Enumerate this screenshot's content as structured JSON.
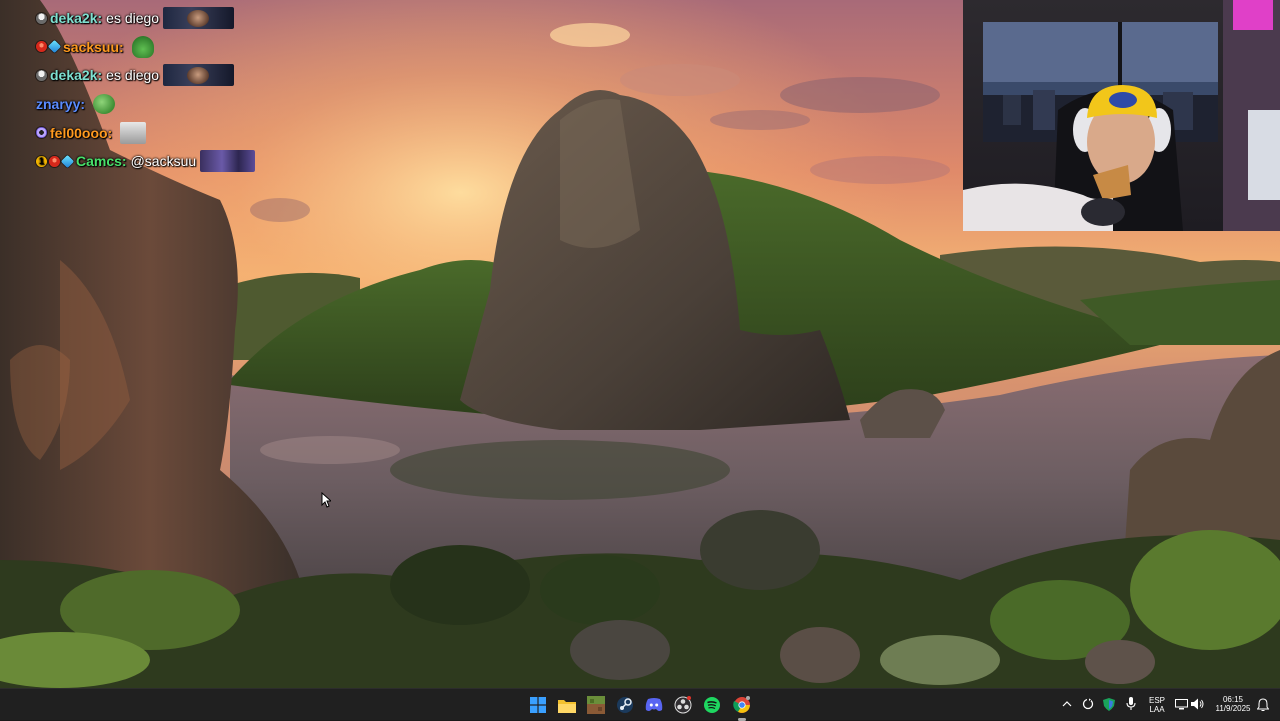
{
  "chat": {
    "messages": [
      {
        "badges": [
          "mod-badge"
        ],
        "user": "deka2k",
        "user_color": "#7ee0d0",
        "text": "es diego",
        "emote": "face-emote"
      },
      {
        "badges": [
          "red-badge",
          "cube-badge"
        ],
        "user": "sacksuu",
        "user_color": "#ff9a1f",
        "text": "",
        "emote": "frog-emote"
      },
      {
        "badges": [
          "mod-badge"
        ],
        "user": "deka2k",
        "user_color": "#7ee0d0",
        "text": "es diego",
        "emote": "face-emote"
      },
      {
        "badges": [],
        "user": "znaryy",
        "user_color": "#5b8cff",
        "text": "",
        "emote": "pepe-emote"
      },
      {
        "badges": [
          "ring-badge"
        ],
        "user": "fel00ooo",
        "user_color": "#ff9a1f",
        "text": "",
        "emote": "meme-emote"
      },
      {
        "badges": [
          "one-badge",
          "red-badge",
          "cube-badge"
        ],
        "user": "Camcs",
        "user_color": "#48e06a",
        "text": "@sacksuu",
        "emote": "group-emote"
      }
    ]
  },
  "taskbar": {
    "apps": [
      {
        "name": "start-button",
        "icon": "windows-icon"
      },
      {
        "name": "file-explorer-app",
        "icon": "folder-icon"
      },
      {
        "name": "minecraft-app",
        "icon": "minecraft-icon"
      },
      {
        "name": "steam-app",
        "icon": "steam-icon"
      },
      {
        "name": "discord-app",
        "icon": "discord-icon"
      },
      {
        "name": "obs-app",
        "icon": "obs-icon"
      },
      {
        "name": "spotify-app",
        "icon": "spotify-icon"
      },
      {
        "name": "chrome-app",
        "icon": "chrome-icon"
      }
    ],
    "tray": {
      "language_top": "ESP",
      "language_bottom": "LAA",
      "time": "06:15",
      "date": "11/9/2025"
    }
  },
  "colors": {
    "taskbar_bg": "#202020",
    "sky_glow": "#f2a05a"
  }
}
